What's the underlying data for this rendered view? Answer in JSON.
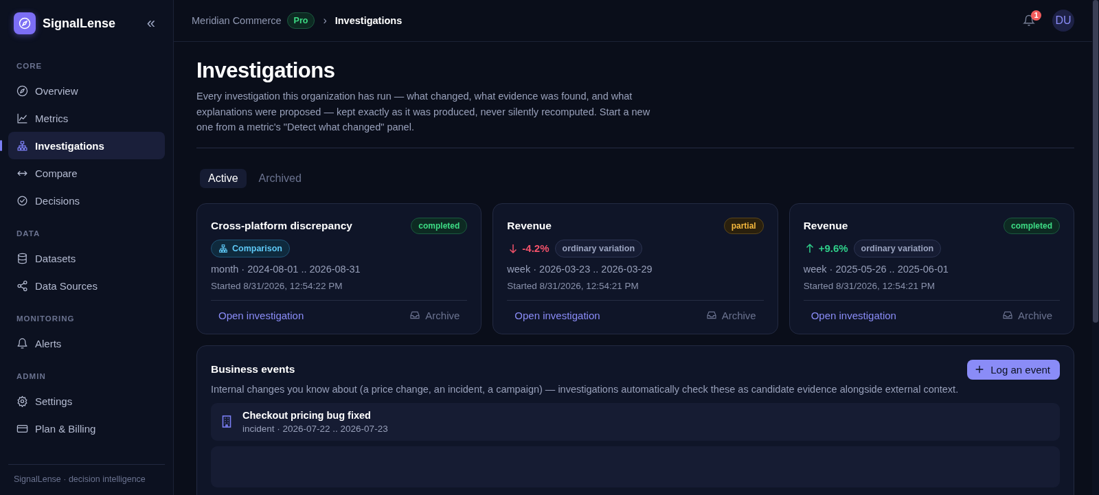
{
  "sidebar": {
    "brand": "SignalLense",
    "collapse_icon": "«",
    "sections": [
      {
        "title": "CORE",
        "items": [
          {
            "label": "Overview",
            "selected": false
          },
          {
            "label": "Metrics",
            "selected": false
          },
          {
            "label": "Investigations",
            "selected": true
          },
          {
            "label": "Compare",
            "selected": false
          },
          {
            "label": "Decisions",
            "selected": false
          }
        ]
      },
      {
        "title": "DATA",
        "items": [
          {
            "label": "Datasets",
            "selected": false
          },
          {
            "label": "Data Sources",
            "selected": false
          }
        ]
      },
      {
        "title": "MONITORING",
        "items": [
          {
            "label": "Alerts",
            "selected": false
          }
        ]
      },
      {
        "title": "ADMIN",
        "items": [
          {
            "label": "Settings",
            "selected": false
          },
          {
            "label": "Plan & Billing",
            "selected": false
          }
        ]
      }
    ],
    "footer": "SignalLense · decision intelligence"
  },
  "header": {
    "breadcrumb": {
      "organization": "Meridian Commerce",
      "plan": "Pro",
      "separator": "›",
      "current": "Investigations"
    },
    "notification_count": "1",
    "avatar": "DU"
  },
  "page": {
    "title": "Investigations",
    "description": "Every investigation this organization has run — what changed, what evidence was found, and what explanations were proposed — kept exactly as it was produced, never silently recomputed. Start a new one from a metric's \"Detect what changed\" panel."
  },
  "tabs": [
    {
      "label": "Active",
      "selected": true
    },
    {
      "label": "Archived",
      "selected": false
    }
  ],
  "cards": [
    {
      "title": "Cross-platform discrepancy",
      "status": "completed",
      "kind": "comparison",
      "tag": "Comparison",
      "period": "month · 2024-08-01 .. 2026-08-31",
      "started": "Started 8/31/2026, 12:54:22 PM",
      "open": "Open investigation",
      "archive": "Archive"
    },
    {
      "title": "Revenue",
      "status": "partial",
      "kind": "change",
      "declining": true,
      "change": "-4.2%",
      "classification": "ordinary variation",
      "period": "week · 2026-03-23 .. 2026-03-29",
      "started": "Started 8/31/2026, 12:54:21 PM",
      "open": "Open investigation",
      "archive": "Archive"
    },
    {
      "title": "Revenue",
      "status": "completed",
      "kind": "change",
      "declining": false,
      "change": "+9.6%",
      "classification": "ordinary variation",
      "period": "week · 2025-05-26 .. 2025-06-01",
      "started": "Started 8/31/2026, 12:54:21 PM",
      "open": "Open investigation",
      "archive": "Archive"
    }
  ],
  "business_events": {
    "title": "Business events",
    "button": "Log an event",
    "description": "Internal changes you know about (a price change, an incident, a campaign) — investigations automatically check these as candidate evidence alongside external context.",
    "events": [
      {
        "title": "Checkout pricing bug fixed",
        "meta": "incident · 2026-07-22 .. 2026-07-23"
      }
    ]
  }
}
